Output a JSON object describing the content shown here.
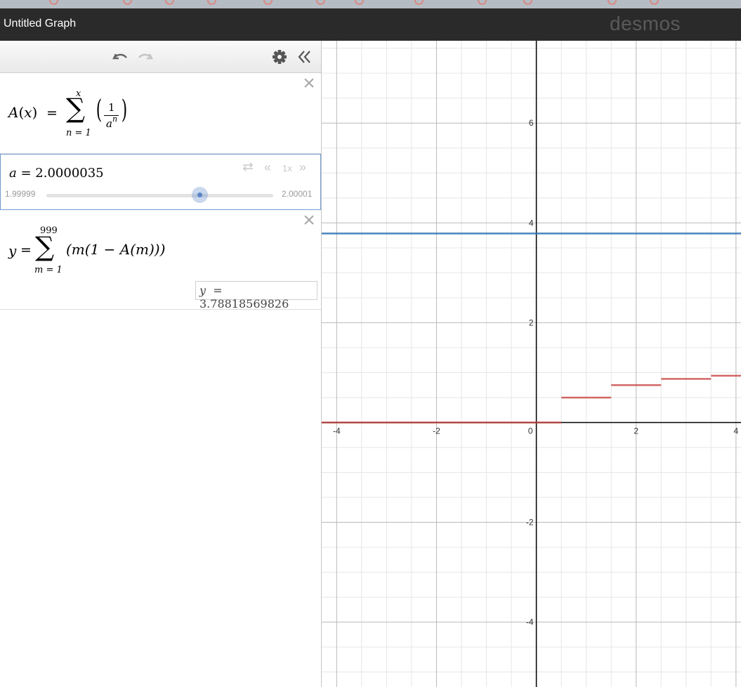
{
  "app": {
    "title": "Untitled Graph",
    "brand": "desmos"
  },
  "toolbar": {
    "undo_icon": "undo-icon",
    "redo_icon": "redo-icon",
    "settings_icon": "gear-icon",
    "collapse_icon": "double-chevron-left-icon"
  },
  "expressions": [
    {
      "id": 1,
      "lhs": "A(x)",
      "equals": "=",
      "sum_upper": "x",
      "sum_lower": "n = 1",
      "numerator": "1",
      "denominator_base": "a",
      "denominator_exp": "n",
      "color": "#c74440"
    },
    {
      "id": 2,
      "variable": "a",
      "equals": "=",
      "value": "2.0000035",
      "slider_min": "1.99999",
      "slider_max": "2.00001",
      "slider_fraction": 0.675,
      "speed": "1x"
    },
    {
      "id": 3,
      "lhs": "y",
      "equals": "=",
      "sum_upper": "999",
      "sum_lower": "m = 1",
      "summand": "(m(1 − A(m)))",
      "result_lhs": "y",
      "result_eq": "=",
      "result_value": "3.78818569826",
      "color": "#2d70b3"
    }
  ],
  "graph": {
    "x_ticks": [
      "-4",
      "-2",
      "0",
      "2",
      "4"
    ],
    "y_ticks": [
      "6",
      "4",
      "2",
      "-2",
      "-4"
    ],
    "x_range": [
      -4.3,
      4.1
    ],
    "y_range": [
      -5.3,
      7.65
    ],
    "horizontal_line_y": 3.78818569826,
    "line_color": "#2d70b3",
    "step_color": "#c74440",
    "step_segments": [
      {
        "x0": -4.3,
        "x1": 0.5,
        "y": 0
      },
      {
        "x0": 0.5,
        "x1": 1.5,
        "y": 0.5
      },
      {
        "x0": 1.5,
        "x1": 2.5,
        "y": 0.75
      },
      {
        "x0": 2.5,
        "x1": 3.5,
        "y": 0.875
      },
      {
        "x0": 3.5,
        "x1": 4.1,
        "y": 0.9375
      }
    ]
  }
}
